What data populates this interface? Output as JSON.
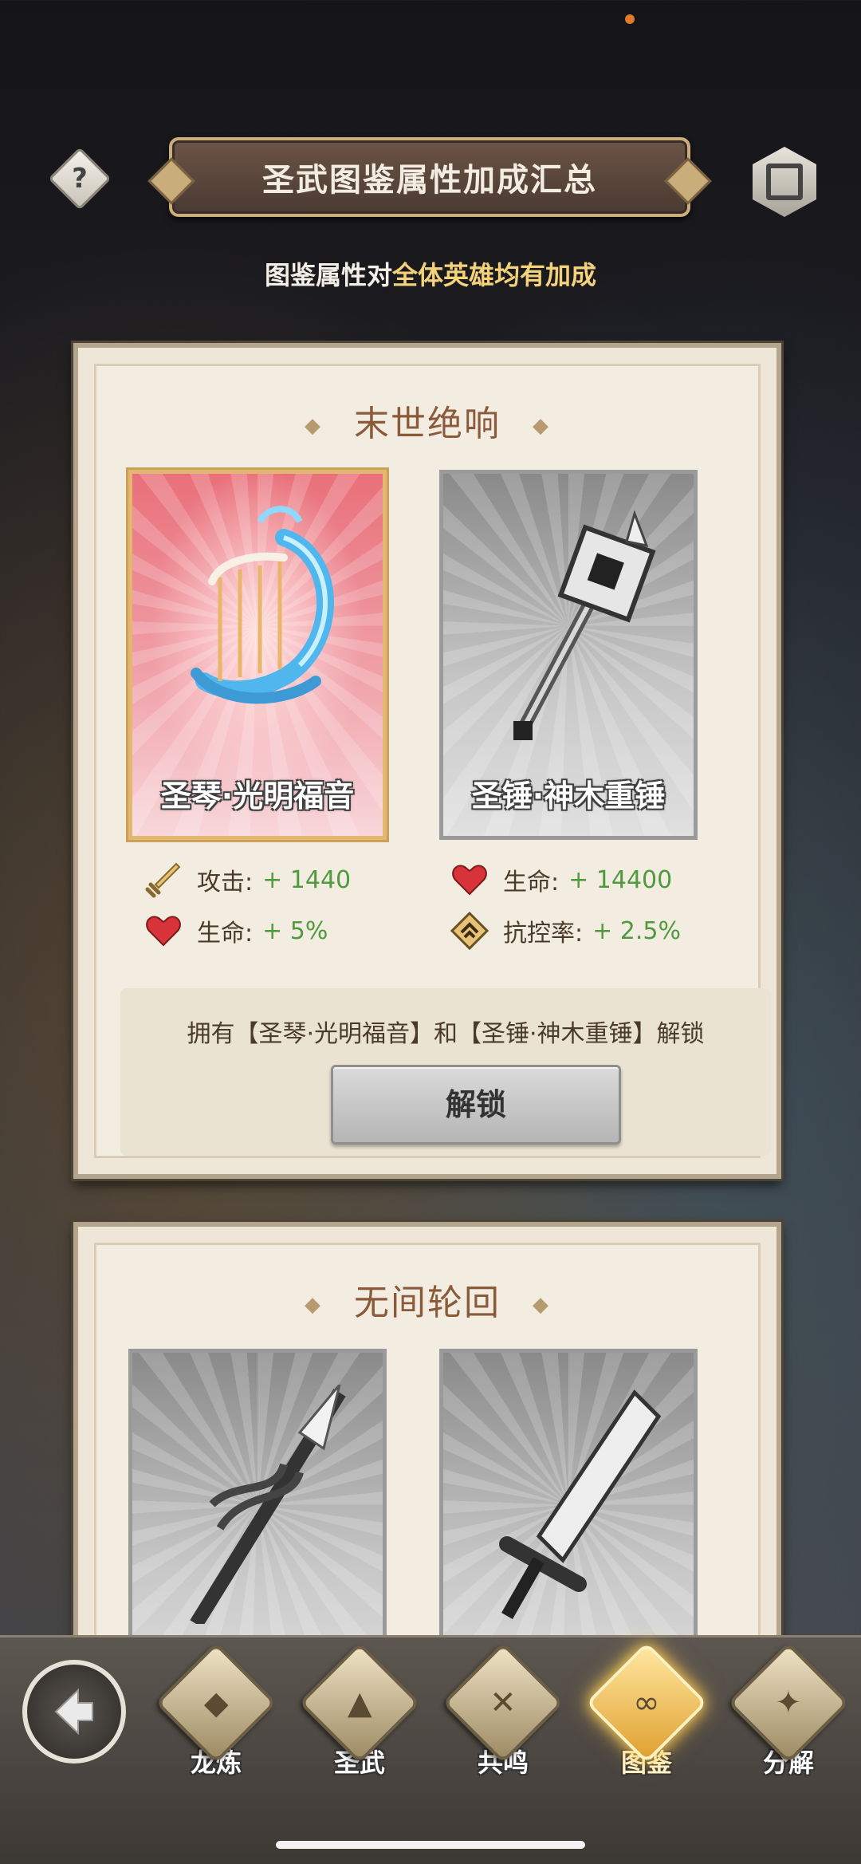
{
  "header": {
    "title": "圣武图鉴属性加成汇总",
    "help_label": "?",
    "subtitle_prefix": "图鉴属性对",
    "subtitle_highlight": "全体英雄均有加成"
  },
  "sets": [
    {
      "title": "末世绝响",
      "weapons": [
        {
          "name": "圣琴·光明福音",
          "owned": true
        },
        {
          "name": "圣锤·神木重锤",
          "owned": false
        }
      ],
      "stats": [
        {
          "icon": "sword-icon",
          "label": "攻击:",
          "value": "+ 1440"
        },
        {
          "icon": "heart-icon",
          "label": "生命:",
          "value": "+ 14400"
        },
        {
          "icon": "heart-icon",
          "label": "生命:",
          "value": "+ 5%"
        },
        {
          "icon": "shield-up-icon",
          "label": "抗控率:",
          "value": "+ 2.5%"
        }
      ],
      "requirement": "拥有【圣琴·光明福音】和【圣锤·神木重锤】解锁",
      "unlock_label": "解锁"
    },
    {
      "title": "无间轮回",
      "weapons": [
        {
          "name": "",
          "owned": false
        },
        {
          "name": "",
          "owned": false
        }
      ]
    }
  ],
  "nav": {
    "items": [
      {
        "label": "龙炼",
        "active": false
      },
      {
        "label": "圣武",
        "active": false
      },
      {
        "label": "共鸣",
        "active": false
      },
      {
        "label": "图鉴",
        "active": true
      },
      {
        "label": "分解",
        "active": false
      }
    ]
  },
  "colors": {
    "stat_value": "#4f9a3e",
    "highlight": "#f3d27a",
    "active_card_border": "#e2b870"
  }
}
